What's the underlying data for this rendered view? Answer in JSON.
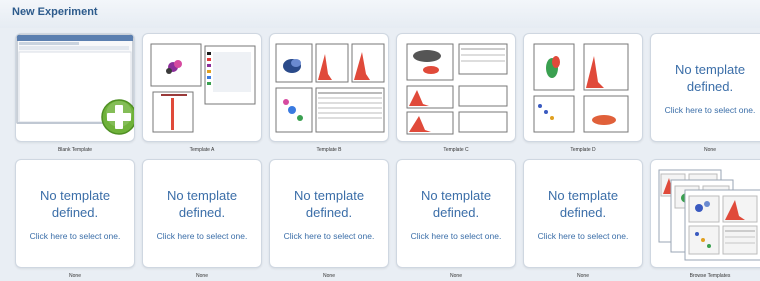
{
  "header": {
    "title": "New Experiment"
  },
  "no_template": {
    "line1": "No template",
    "line2": "defined.",
    "hint": "Click here to select one."
  },
  "tiles": [
    {
      "caption": "Blank Template",
      "kind": "blank"
    },
    {
      "caption": "Template A",
      "kind": "preview"
    },
    {
      "caption": "Template B",
      "kind": "preview"
    },
    {
      "caption": "Template C",
      "kind": "preview"
    },
    {
      "caption": "Template D",
      "kind": "preview"
    },
    {
      "caption": "None",
      "kind": "none"
    },
    {
      "caption": "None",
      "kind": "none"
    },
    {
      "caption": "None",
      "kind": "none"
    },
    {
      "caption": "None",
      "kind": "none"
    },
    {
      "caption": "None",
      "kind": "none"
    },
    {
      "caption": "None",
      "kind": "none"
    },
    {
      "caption": "Browse Templates",
      "kind": "browse"
    }
  ],
  "icons": {
    "add": "plus-icon"
  },
  "colors": {
    "accent_text": "#3b6ea8",
    "plus_green": "#6fb23a",
    "plot_red": "#e04a3a"
  }
}
